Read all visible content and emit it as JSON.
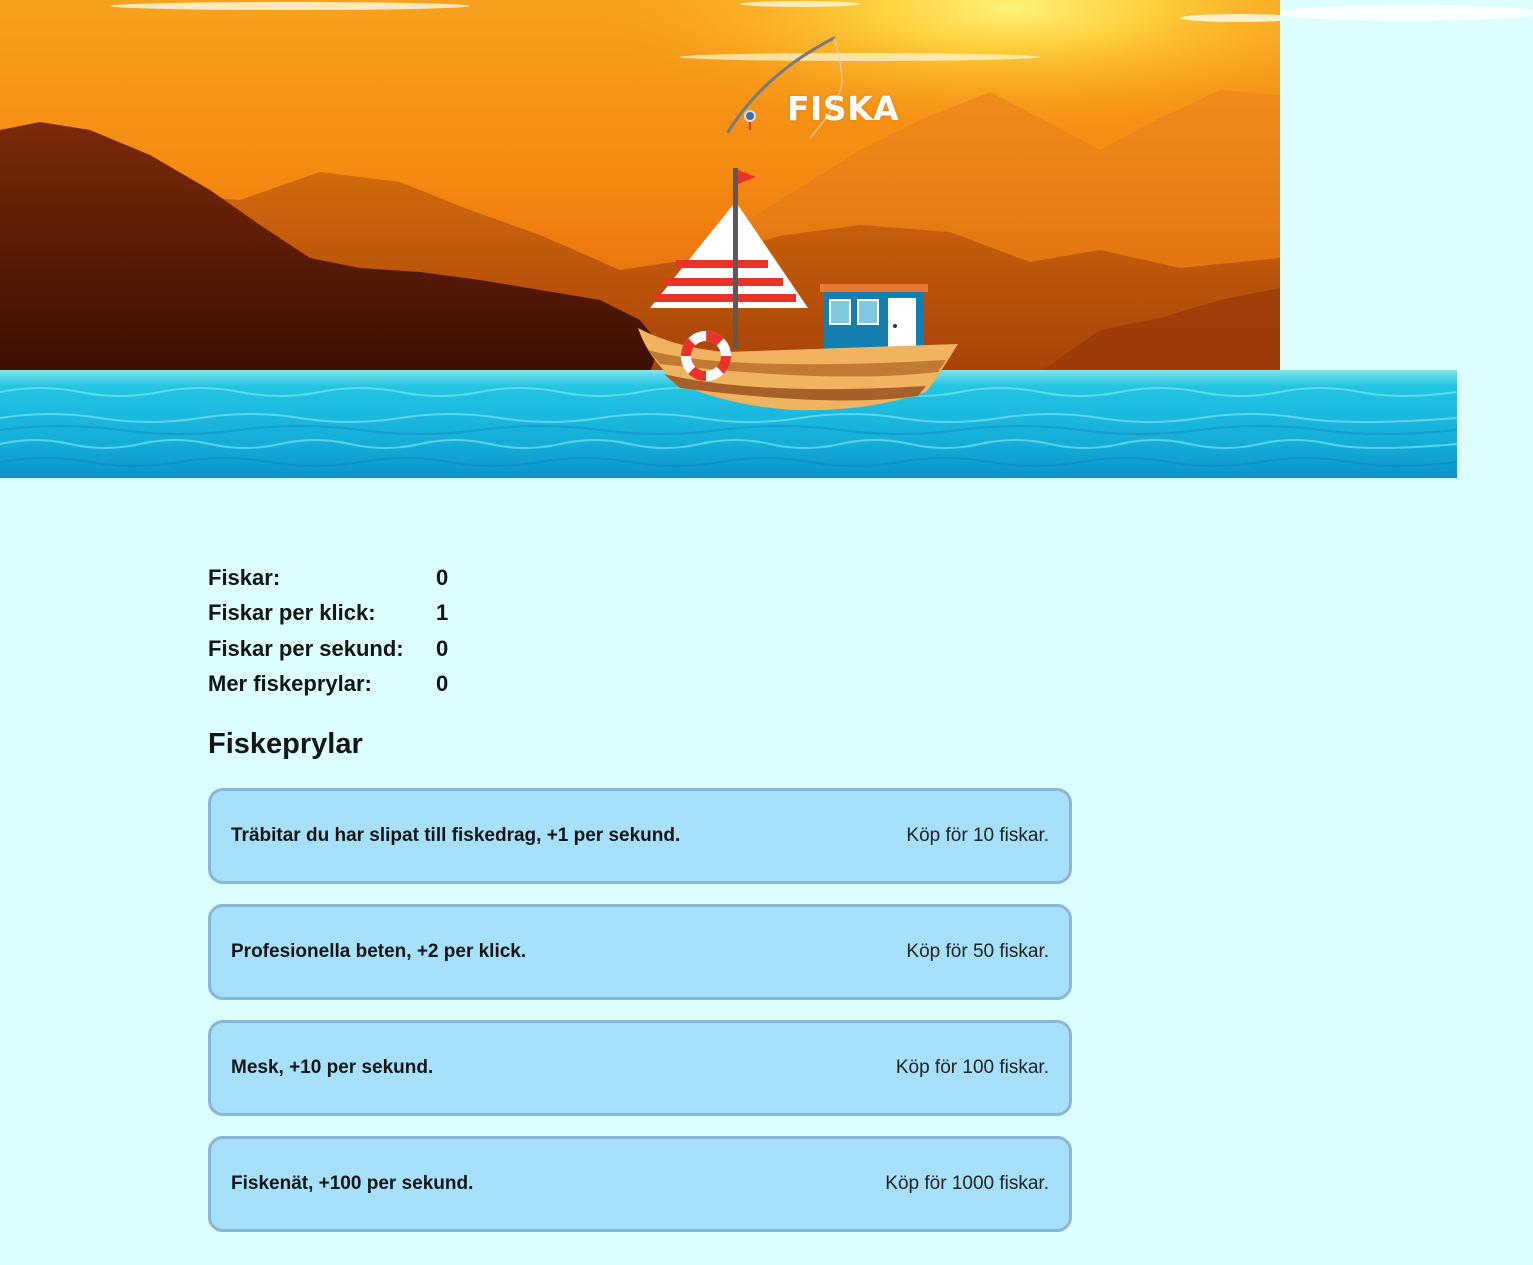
{
  "header": {
    "title": "FISKA"
  },
  "stats": [
    {
      "label": "Fiskar:",
      "value": "0"
    },
    {
      "label": "Fiskar per klick:",
      "value": "1"
    },
    {
      "label": "Fiskar per sekund:",
      "value": "0"
    },
    {
      "label": "Mer fiskeprylar:",
      "value": "0"
    }
  ],
  "shop": {
    "title": "Fiskeprylar",
    "items": [
      {
        "description": "Träbitar du har slipat till fiskedrag, +1 per sekund.",
        "price": "Köp för 10 fiskar."
      },
      {
        "description": "Profesionella beten, +2 per klick.",
        "price": "Köp för 50 fiskar."
      },
      {
        "description": "Mesk, +10 per sekund.",
        "price": "Köp för 100 fiskar."
      },
      {
        "description": "Fiskenät, +100 per sekund.",
        "price": "Köp för 1000 fiskar."
      }
    ]
  },
  "colors": {
    "page_background": "#dcfefe",
    "item_background": "#a6e0fa",
    "item_border": "#88b8d6",
    "sky_top": "#f9a21c",
    "water": "#1ab8dc"
  }
}
